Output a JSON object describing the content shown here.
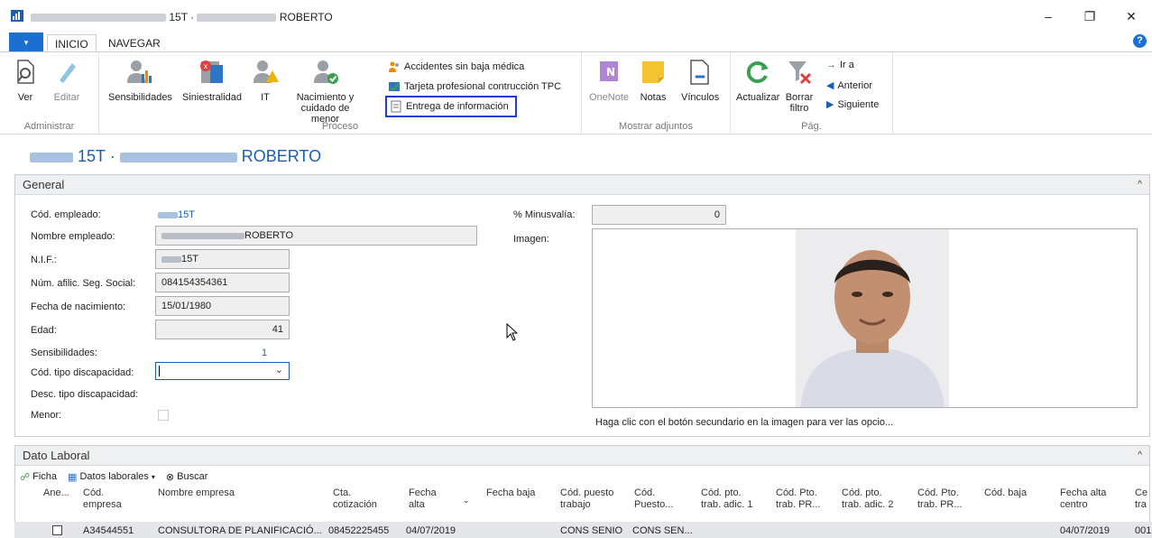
{
  "window": {
    "title_code": "15T ·",
    "title_name": "ROBERTO",
    "minimize": "–",
    "restore": "❐",
    "close": "✕"
  },
  "tabs": {
    "menu": "▾",
    "inicio": "INICIO",
    "navegar": "NAVEGAR",
    "help": "?"
  },
  "ribbon": {
    "administrar": {
      "label": "Administrar",
      "ver": "Ver",
      "editar": "Editar"
    },
    "proceso": {
      "label": "Proceso",
      "sensibilidades": "Sensibilidades",
      "siniestralidad": "Siniestralidad",
      "it": "IT",
      "nacimiento_line1": "Nacimiento y",
      "nacimiento_line2": "cuidado de menor",
      "accidentes": "Accidentes sin baja médica",
      "tarjeta": "Tarjeta profesional contrucción TPC",
      "entrega": "Entrega de información"
    },
    "adjuntos": {
      "label": "Mostrar adjuntos",
      "onenote": "OneNote",
      "notas": "Notas",
      "vinculos": "Vínculos"
    },
    "pag": {
      "label": "Pág.",
      "actualizar": "Actualizar",
      "borrar_line1": "Borrar",
      "borrar_line2": "filtro",
      "ira": "Ir a",
      "anterior": "Anterior",
      "siguiente": "Siguiente"
    }
  },
  "page_title": {
    "code": "15T ·",
    "name": "ROBERTO"
  },
  "general": {
    "header": "General",
    "cod_empleado_label": "Cód. empleado:",
    "cod_empleado_value": "15T",
    "nombre_label": "Nombre empleado:",
    "nombre_value": "ROBERTO",
    "nif_label": "N.I.F.:",
    "nif_value": "15T",
    "afil_label": "Núm. afilic. Seg. Social:",
    "afil_value": "084154354361",
    "fecha_nac_label": "Fecha de nacimiento:",
    "fecha_nac_value": "15/01/1980",
    "edad_label": "Edad:",
    "edad_value": "41",
    "sensibilidades_label": "Sensibilidades:",
    "sensibilidades_value": "1",
    "tipo_disc_label": "Cód. tipo discapacidad:",
    "desc_disc_label": "Desc. tipo discapacidad:",
    "menor_label": "Menor:",
    "minusvalia_label": "% Minusvalía:",
    "minusvalia_value": "0",
    "imagen_label": "Imagen:",
    "imagen_hint": "Haga clic con el botón secundario en la imagen para ver las opcio..."
  },
  "dato_laboral": {
    "header": "Dato Laboral",
    "ficha": "Ficha",
    "datos_laborales": "Datos laborales",
    "buscar": "Buscar",
    "columns": [
      [
        "Ane..."
      ],
      [
        "Cód.",
        "empresa"
      ],
      [
        "Nombre empresa"
      ],
      [
        "Cta.",
        "cotización"
      ],
      [
        "Fecha",
        "alta"
      ],
      [
        "Fecha baja"
      ],
      [
        "Cód. puesto",
        "trabajo"
      ],
      [
        "Cód.",
        "Puesto..."
      ],
      [
        "Cód. pto.",
        "trab. adic. 1"
      ],
      [
        "Cód. Pto.",
        "trab. PR..."
      ],
      [
        "Cód. pto.",
        "trab. adic. 2"
      ],
      [
        "Cód. Pto.",
        "trab. PR..."
      ],
      [
        "Cód. baja"
      ],
      [
        "Fecha alta",
        "centro"
      ],
      [
        "Ce",
        "tra"
      ]
    ],
    "row": {
      "cod_empresa": "A34544551",
      "nombre_empresa": "CONSULTORA DE PLANIFICACIÓ...",
      "cta_cotizacion": "08452225455",
      "fecha_alta": "04/07/2019",
      "cod_puesto": "CONS SENIO",
      "puesto": "CONS SEN...",
      "fecha_alta_centro": "04/07/2019",
      "centro": "001"
    }
  },
  "colors": {
    "accent": "#1a5fb4",
    "highlight": "#1f3fcf",
    "brand": "#1a6fd0"
  }
}
